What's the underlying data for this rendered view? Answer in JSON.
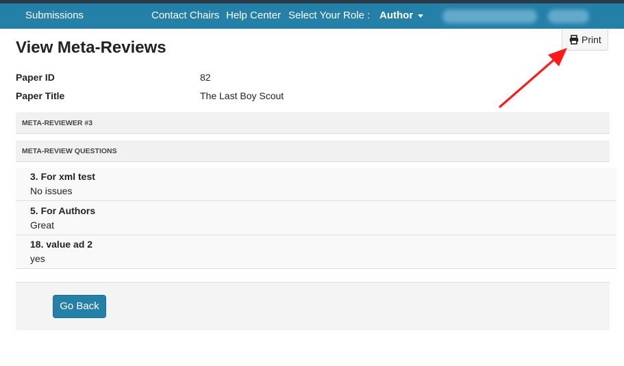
{
  "nav": {
    "submissions": "Submissions",
    "contact_chairs": "Contact Chairs",
    "help_center": "Help Center",
    "role_label": "Select Your Role :",
    "role_value": "Author"
  },
  "page": {
    "title": "View Meta-Reviews",
    "print_label": "Print"
  },
  "paper": {
    "id_label": "Paper ID",
    "id_value": "82",
    "title_label": "Paper Title",
    "title_value": "The Last Boy Scout"
  },
  "sections": {
    "meta_reviewer": "META-REVIEWER #3",
    "questions": "META-REVIEW QUESTIONS"
  },
  "qa": [
    {
      "question": "3. For xml test",
      "answer": "No issues"
    },
    {
      "question": "5. For Authors",
      "answer": "Great"
    },
    {
      "question": "18. value ad 2",
      "answer": "yes"
    }
  ],
  "footer": {
    "go_back_label": "Go Back"
  },
  "colors": {
    "navbar": "#2580a8",
    "topstrip": "#2b3a4a",
    "annotation_arrow": "#ff1a1a"
  }
}
